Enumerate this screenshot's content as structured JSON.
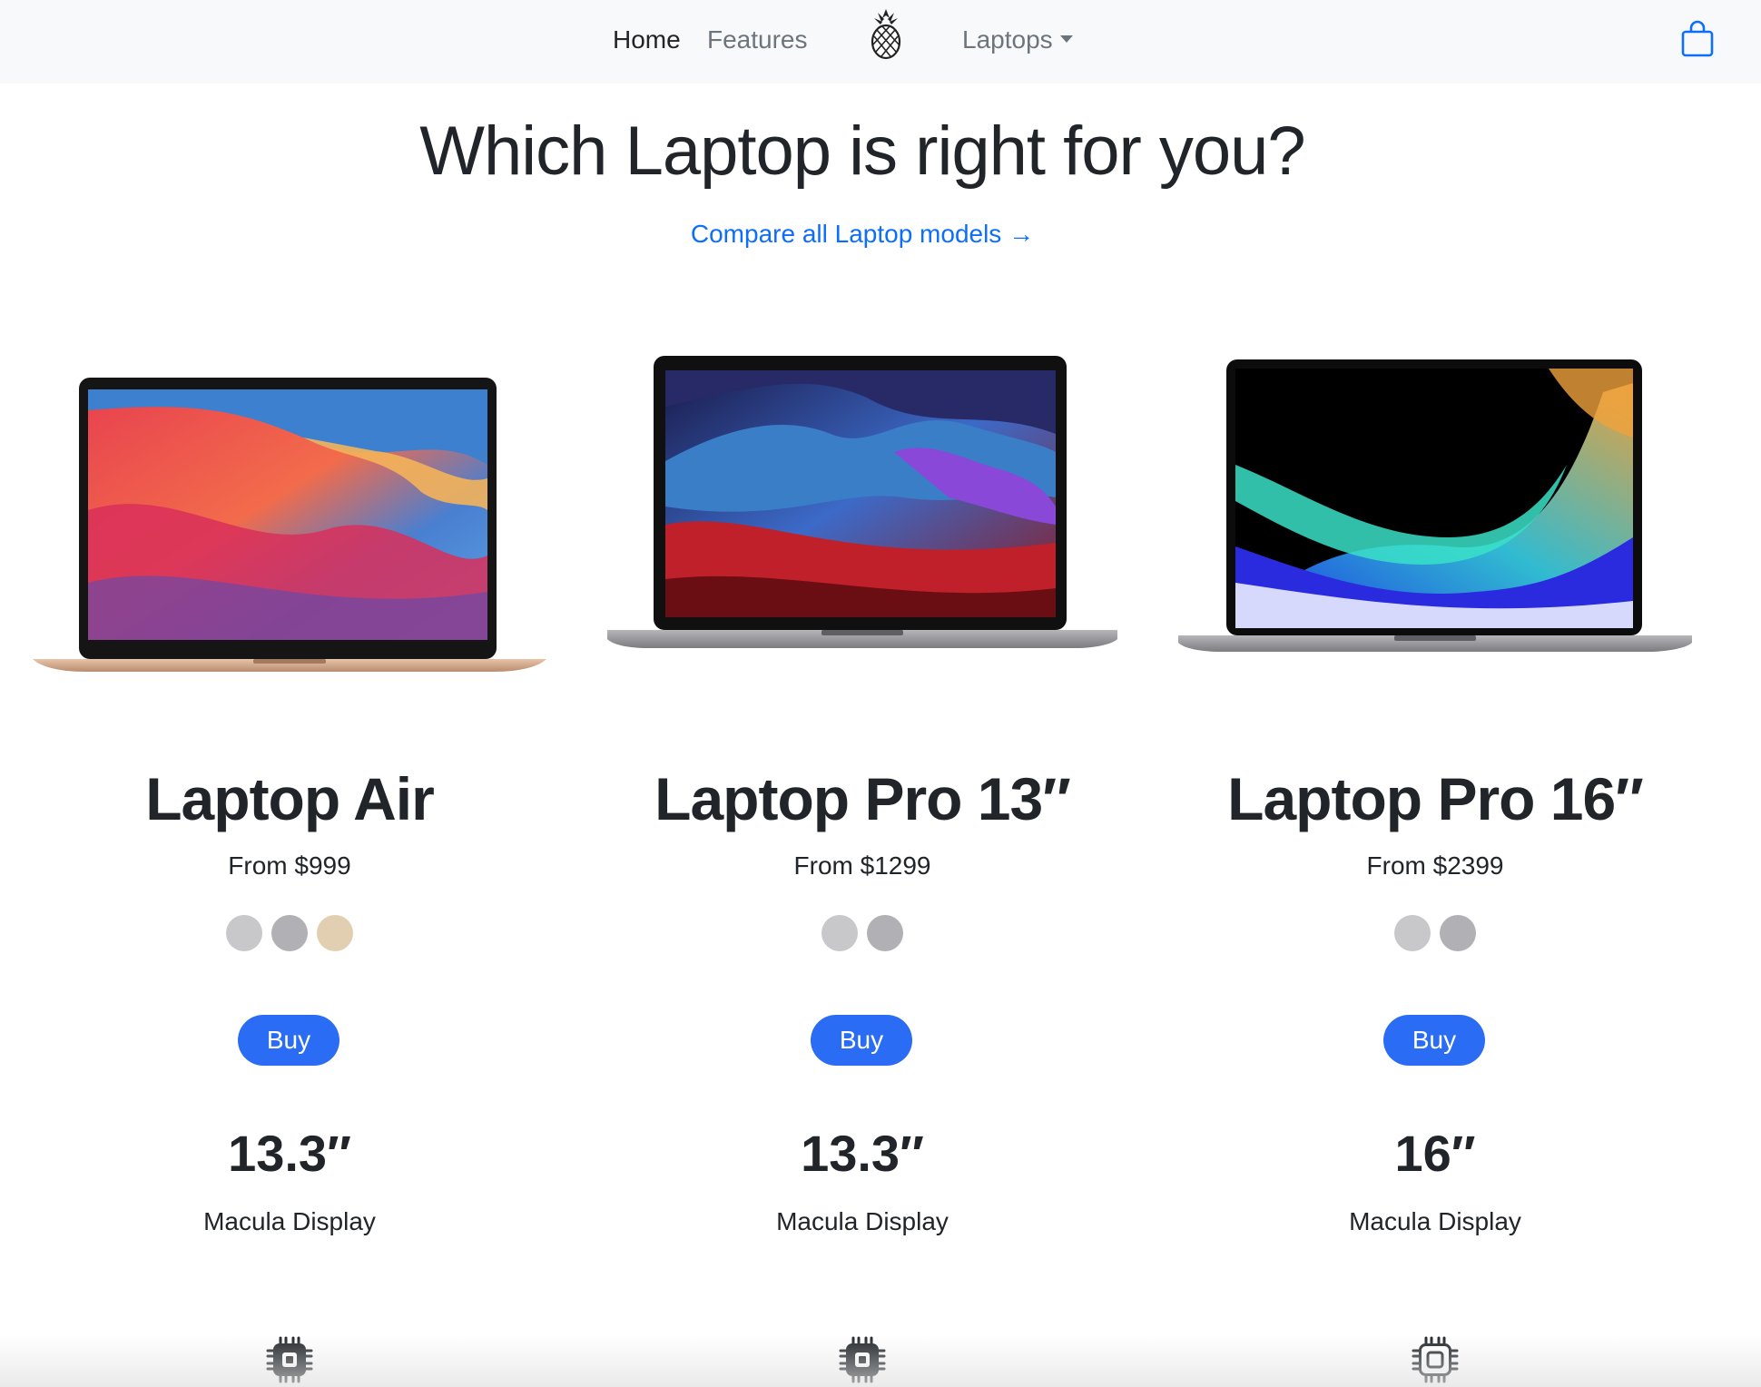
{
  "nav": {
    "home": "Home",
    "features": "Features",
    "laptops": "Laptops",
    "logo_icon": "pineapple-logo-icon",
    "bag_icon": "shopping-bag-icon"
  },
  "header": {
    "title": "Which Laptop is right for you?",
    "compare_link": "Compare all Laptop models →"
  },
  "colors": {
    "link": "#0d6efd",
    "button": "#2a6df4",
    "silver": "#c8c8ca",
    "space_gray": "#b0b0b5",
    "gold": "#e2cfb2"
  },
  "products": [
    {
      "name": "Laptop Air",
      "price": "From $999",
      "swatches": [
        "#c8c8ca",
        "#b0b0b5",
        "#e2cfb2"
      ],
      "buy": "Buy",
      "display_size": "13.3″",
      "display_label": "Macula Display",
      "chip_icon": "chip-filled-icon"
    },
    {
      "name": "Laptop Pro 13″",
      "price": "From $1299",
      "swatches": [
        "#c8c8ca",
        "#b0b0b5"
      ],
      "buy": "Buy",
      "display_size": "13.3″",
      "display_label": "Macula Display",
      "chip_icon": "chip-filled-icon"
    },
    {
      "name": "Laptop Pro 16″",
      "price": "From $2399",
      "swatches": [
        "#c8c8ca",
        "#b0b0b5"
      ],
      "buy": "Buy",
      "display_size": "16″",
      "display_label": "Macula Display",
      "chip_icon": "chip-outline-icon"
    }
  ]
}
